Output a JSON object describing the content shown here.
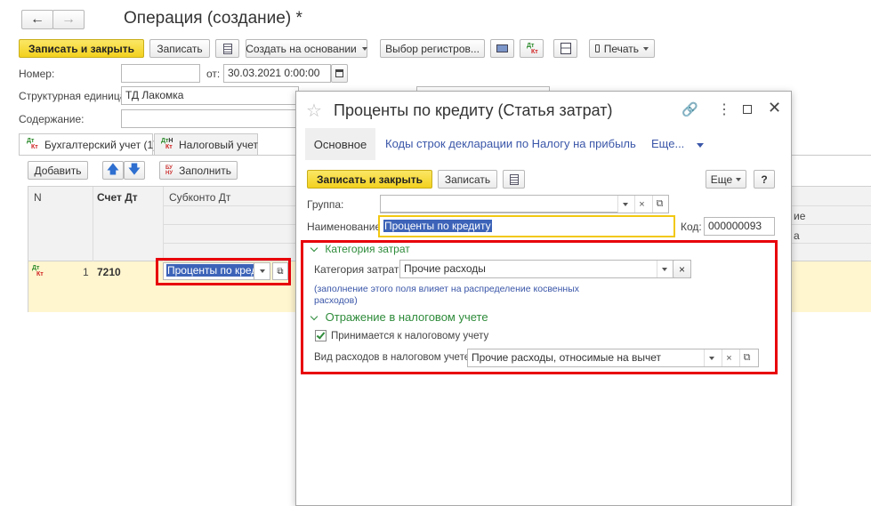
{
  "doc": {
    "title": "Операция (создание) *",
    "toolbar": {
      "save_close": "Записать и закрыть",
      "save": "Записать",
      "create_based": "Создать на основании",
      "registers": "Выбор регистров...",
      "print": "Печать"
    },
    "fields": {
      "number_label": "Номер:",
      "date_label": "от:",
      "date_value": "30.03.2021  0:00:00",
      "unit_label": "Структурная единица:",
      "unit_value": "ТД Лакомка",
      "content_label": "Содержание:"
    },
    "tabs": {
      "accounting": "Бухгалтерский учет (1)",
      "tax": "Налоговый учет"
    },
    "table_toolbar": {
      "add": "Добавить",
      "fill": "Заполнить",
      "fill_icon_text": "БУ НУ"
    },
    "table": {
      "col_n": "N",
      "col_account_dt": "Счет Дт",
      "col_subconto_dt": "Субконто Дт",
      "right_header_1": "ие",
      "right_row_1": "а",
      "rows": [
        {
          "n": "1",
          "account": "7210",
          "subconto": "Проценты по кред"
        }
      ]
    },
    "dtkt": {
      "dt": "Дт",
      "kt": "Кт",
      "h": "Н"
    }
  },
  "dialog": {
    "title": "Проценты по кредиту (Статья затрат)",
    "tabs": {
      "main": "Основное",
      "codes": "Коды строк декларации по Налогу на прибыль",
      "more": "Еще..."
    },
    "toolbar": {
      "save_close": "Записать и закрыть",
      "save": "Записать",
      "more": "Еще",
      "help": "?"
    },
    "fields": {
      "group_label": "Группа:",
      "name_label": "Наименование:",
      "name_value": "Проценты по кредиту",
      "code_label": "Код:",
      "code_value": "000000093"
    },
    "cost_category": {
      "section": "Категория затрат",
      "label": "Категория затрат:",
      "value": "Прочие расходы",
      "note": "(заполнение этого поля влияет на распределение косвенных расходов)"
    },
    "tax": {
      "section": "Отражение в налоговом учете",
      "accepted_label": "Принимается к налоговому учету",
      "accepted": true,
      "expense_type_label": "Вид расходов в налоговом учете:",
      "expense_type_value": "Прочие расходы, относимые на вычет"
    }
  },
  "colors": {
    "highlight_red": "#e8000b",
    "yellow_button": "#f3d11e",
    "selection_blue": "#3c63b8",
    "section_green": "#2e8b3a",
    "link_blue": "#3a56a8",
    "row_yellow": "#fff5cf"
  }
}
